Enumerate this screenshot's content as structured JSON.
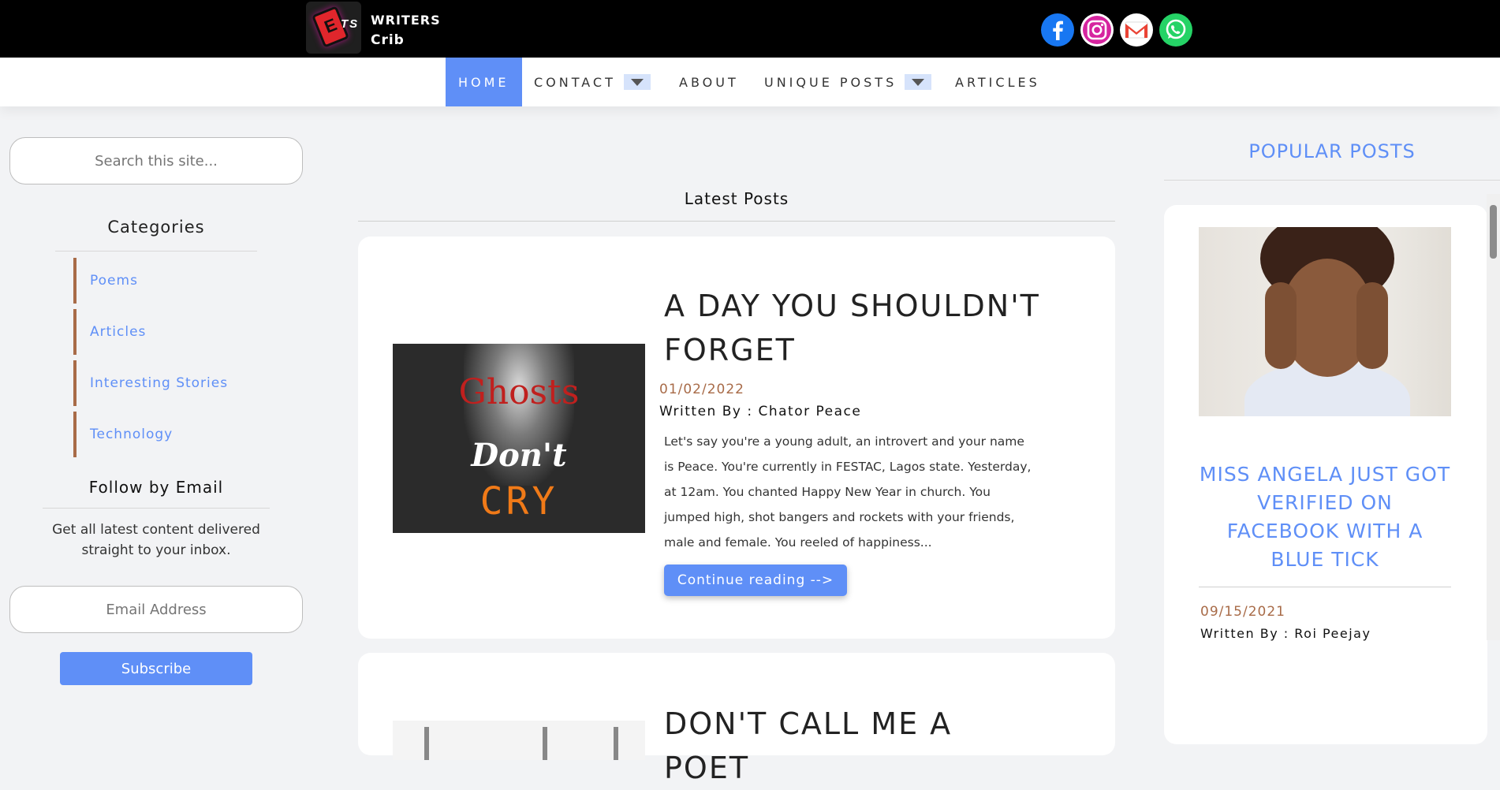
{
  "header": {
    "brand_line1": "WRITERS",
    "brand_line2": "Crib",
    "logo_text_e": "E",
    "logo_text_ts": "TS",
    "social_icons": [
      "facebook-icon",
      "instagram-icon",
      "gmail-icon",
      "whatsapp-icon"
    ]
  },
  "nav": {
    "items": [
      {
        "label": "HOME",
        "active": true
      },
      {
        "label": "CONTACT",
        "dropdown": true
      },
      {
        "label": "ABOUT"
      },
      {
        "label": "UNIQUE POSTS",
        "dropdown": true
      },
      {
        "label": "ARTICLES"
      }
    ]
  },
  "sidebar_left": {
    "search_placeholder": "Search this site...",
    "categories_title": "Categories",
    "categories": [
      "Poems",
      "Articles",
      "Interesting Stories",
      "Technology"
    ],
    "follow_title": "Follow by Email",
    "follow_desc": "Get all latest content delivered straight to your inbox.",
    "email_placeholder": "Email Address",
    "subscribe_label": "Subscribe"
  },
  "main": {
    "section_title": "Latest Posts",
    "posts": [
      {
        "title": "A DAY YOU SHOULDN'T FORGET",
        "date": "01/02/2022",
        "author": "Written By : Chator Peace",
        "excerpt": "Let's say you're a young adult, an introvert and your name is Peace. You're currently in FESTAC, Lagos state. Yesterday, at 12am. You chanted Happy New Year in church. You jumped high, shot bangers and rockets with your friends, male and female. You reeled of happiness...",
        "button": "Continue reading -->",
        "thumb_words": [
          "Ghosts",
          "Don't",
          "CRY"
        ]
      },
      {
        "title": "DON'T CALL ME A POET"
      }
    ]
  },
  "sidebar_right": {
    "popular_title": "POPULAR POSTS",
    "post_title": "MISS ANGELA JUST GOT VERIFIED ON FACEBOOK WITH A BLUE TICK",
    "post_date": "09/15/2021",
    "post_author": "Written By : Roi Peejay"
  },
  "colors": {
    "accent": "#5f8ff7",
    "date_brown": "#a86b48",
    "header_bg": "#000000"
  }
}
